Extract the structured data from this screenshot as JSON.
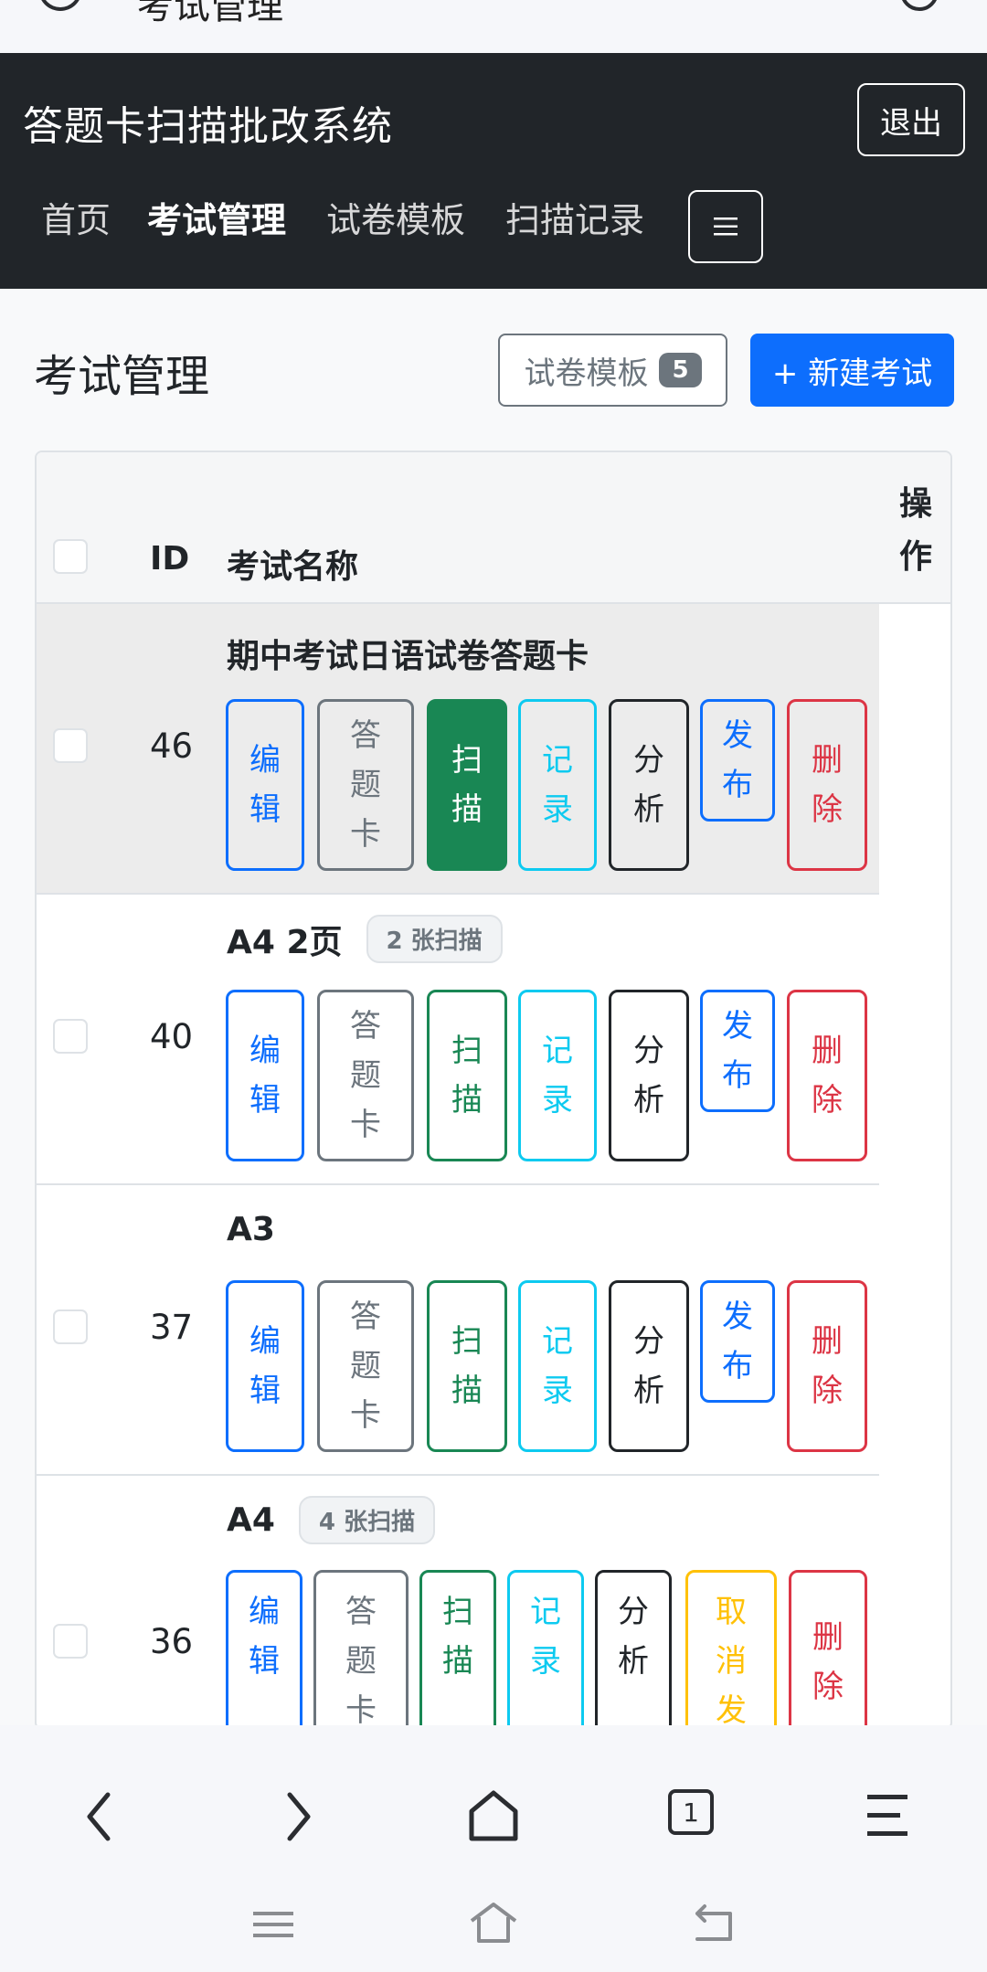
{
  "browser": {
    "url_fragment": "考试管理"
  },
  "navbar": {
    "brand": "答题卡扫描批改系统",
    "logout": "退出",
    "links": [
      "首页",
      "考试管理",
      "试卷模板",
      "扫描记录"
    ],
    "toggle_icon": "menu-icon"
  },
  "page": {
    "title": "考试管理",
    "template_button": "试卷模板",
    "template_count": "5",
    "new_exam_button": "+ 新建考试"
  },
  "table": {
    "headers": {
      "id": "ID",
      "name": "考试名称",
      "op_1": "操",
      "op_2": "作"
    },
    "actions": {
      "edit": [
        "编",
        "辑"
      ],
      "card": [
        "答",
        "题",
        "卡"
      ],
      "scan": [
        "扫",
        "描"
      ],
      "record": [
        "记",
        "录"
      ],
      "analyze": [
        "分",
        "析"
      ],
      "publish": [
        "发",
        "布"
      ],
      "unpublish": [
        "取",
        "消",
        "发"
      ],
      "delete": [
        "删",
        "除"
      ]
    },
    "rows": [
      {
        "id": "46",
        "name": "期中考试日语试卷答题卡",
        "badge": ""
      },
      {
        "id": "40",
        "name": "A4 2页",
        "badge": "2 张扫描"
      },
      {
        "id": "37",
        "name": "A3",
        "badge": ""
      },
      {
        "id": "36",
        "name": "A4",
        "badge": "4 张扫描"
      }
    ]
  },
  "colors": {
    "navbar_bg": "#212529",
    "primary": "#0d6efd",
    "success": "#198754",
    "info": "#0dcaf0",
    "warning": "#ffc107",
    "danger": "#dc3545",
    "secondary": "#6c757d"
  },
  "bottom_toolbar": {
    "icons": [
      "back-icon",
      "forward-icon",
      "home-icon",
      "tabs-icon",
      "menu-icon"
    ],
    "tab_count": "1"
  },
  "system_nav": {
    "icons": [
      "recents-icon",
      "home-icon",
      "back-icon"
    ]
  }
}
